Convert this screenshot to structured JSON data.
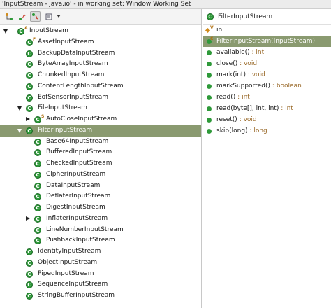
{
  "window": {
    "title": "'InputStream - java.io' - in working set: Window Working Set"
  },
  "colors": {
    "class_icon": "#2f9a3a",
    "selection": "#8a9a70",
    "return_type": "#9a6a2a"
  },
  "toolbar": {
    "buttons": [
      {
        "icon": "type-hierarchy-icon",
        "pressed": false
      },
      {
        "icon": "supertype-hierarchy-icon",
        "pressed": false
      },
      {
        "icon": "subtype-hierarchy-icon",
        "pressed": true
      },
      {
        "icon": "history-icon",
        "pressed": false
      },
      {
        "icon": "view-menu-chevron-icon",
        "pressed": false
      }
    ]
  },
  "tree": {
    "rows": [
      {
        "label": "InputStream",
        "level": 0,
        "expand": "open",
        "icon_letter": "C",
        "badge": "A",
        "selected": false
      },
      {
        "label": "AssetInputStream",
        "level": 1,
        "expand": "none",
        "icon_letter": "C",
        "badge": "F",
        "selected": false
      },
      {
        "label": "BackupDataInputStream",
        "level": 1,
        "expand": "none",
        "icon_letter": "C",
        "badge": "",
        "selected": false
      },
      {
        "label": "ByteArrayInputStream",
        "level": 1,
        "expand": "none",
        "icon_letter": "C",
        "badge": "",
        "selected": false
      },
      {
        "label": "ChunkedInputStream",
        "level": 1,
        "expand": "none",
        "icon_letter": "C",
        "badge": "",
        "selected": false
      },
      {
        "label": "ContentLengthInputStream",
        "level": 1,
        "expand": "none",
        "icon_letter": "C",
        "badge": "",
        "selected": false
      },
      {
        "label": "EofSensorInputStream",
        "level": 1,
        "expand": "none",
        "icon_letter": "C",
        "badge": "",
        "selected": false
      },
      {
        "label": "FileInputStream",
        "level": 1,
        "expand": "open",
        "icon_letter": "C",
        "badge": "",
        "selected": false
      },
      {
        "label": "AutoCloseInputStream",
        "level": 2,
        "expand": "closed",
        "icon_letter": "C",
        "badge": "S",
        "selected": false
      },
      {
        "label": "FilterInputStream",
        "level": 1,
        "expand": "open",
        "icon_letter": "C",
        "badge": "",
        "selected": true
      },
      {
        "label": "Base64InputStream",
        "level": 2,
        "expand": "none",
        "icon_letter": "C",
        "badge": "",
        "selected": false
      },
      {
        "label": "BufferedInputStream",
        "level": 2,
        "expand": "none",
        "icon_letter": "C",
        "badge": "",
        "selected": false
      },
      {
        "label": "CheckedInputStream",
        "level": 2,
        "expand": "none",
        "icon_letter": "C",
        "badge": "",
        "selected": false
      },
      {
        "label": "CipherInputStream",
        "level": 2,
        "expand": "none",
        "icon_letter": "C",
        "badge": "",
        "selected": false
      },
      {
        "label": "DataInputStream",
        "level": 2,
        "expand": "none",
        "icon_letter": "C",
        "badge": "",
        "selected": false
      },
      {
        "label": "DeflaterInputStream",
        "level": 2,
        "expand": "none",
        "icon_letter": "C",
        "badge": "",
        "selected": false
      },
      {
        "label": "DigestInputStream",
        "level": 2,
        "expand": "none",
        "icon_letter": "C",
        "badge": "",
        "selected": false
      },
      {
        "label": "InflaterInputStream",
        "level": 2,
        "expand": "closed",
        "icon_letter": "C",
        "badge": "",
        "selected": false
      },
      {
        "label": "LineNumberInputStream",
        "level": 2,
        "expand": "none",
        "icon_letter": "C",
        "badge": "",
        "selected": false
      },
      {
        "label": "PushbackInputStream",
        "level": 2,
        "expand": "none",
        "icon_letter": "C",
        "badge": "",
        "selected": false
      },
      {
        "label": "IdentityInputStream",
        "level": 1,
        "expand": "none",
        "icon_letter": "C",
        "badge": "",
        "selected": false
      },
      {
        "label": "ObjectInputStream",
        "level": 1,
        "expand": "none",
        "icon_letter": "C",
        "badge": "",
        "selected": false
      },
      {
        "label": "PipedInputStream",
        "level": 1,
        "expand": "none",
        "icon_letter": "C",
        "badge": "",
        "selected": false
      },
      {
        "label": "SequenceInputStream",
        "level": 1,
        "expand": "none",
        "icon_letter": "C",
        "badge": "",
        "selected": false
      },
      {
        "label": "StringBufferInputStream",
        "level": 1,
        "expand": "none",
        "icon_letter": "C",
        "badge": "",
        "selected": false
      }
    ]
  },
  "members": {
    "class_name": "FilterInputStream",
    "class_icon_letter": "C",
    "items": [
      {
        "name": "in",
        "type": "",
        "kind": "field",
        "badge": "V",
        "selected": false
      },
      {
        "name": "FilterInputStream(InputStream)",
        "type": "",
        "kind": "method",
        "badge": "C",
        "selected": true
      },
      {
        "name": "available()",
        "type": "int",
        "kind": "method",
        "badge": "",
        "selected": false
      },
      {
        "name": "close()",
        "type": "void",
        "kind": "method",
        "badge": "",
        "selected": false
      },
      {
        "name": "mark(int)",
        "type": "void",
        "kind": "method",
        "badge": "",
        "selected": false
      },
      {
        "name": "markSupported()",
        "type": "boolean",
        "kind": "method",
        "badge": "",
        "selected": false
      },
      {
        "name": "read()",
        "type": "int",
        "kind": "method",
        "badge": "",
        "selected": false
      },
      {
        "name": "read(byte[], int, int)",
        "type": "int",
        "kind": "method",
        "badge": "",
        "selected": false
      },
      {
        "name": "reset()",
        "type": "void",
        "kind": "method",
        "badge": "",
        "selected": false
      },
      {
        "name": "skip(long)",
        "type": "long",
        "kind": "method",
        "badge": "",
        "selected": false
      }
    ]
  }
}
